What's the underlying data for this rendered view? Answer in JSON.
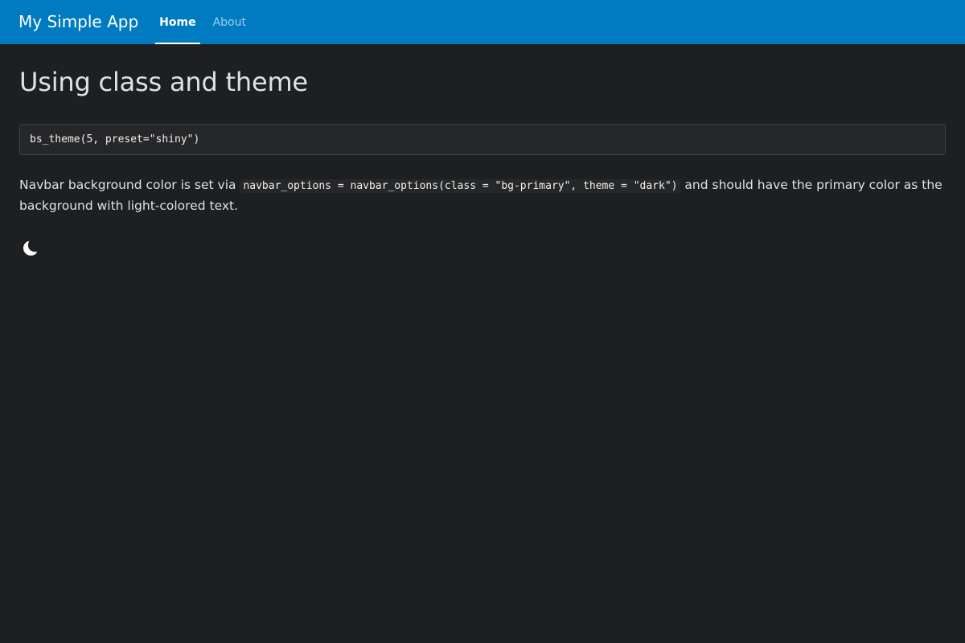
{
  "navbar": {
    "brand": "My Simple App",
    "tabs": [
      {
        "label": "Home",
        "active": true
      },
      {
        "label": "About",
        "active": false
      }
    ],
    "background_color": "#007bc2"
  },
  "main": {
    "heading": "Using class and theme",
    "code_block": "bs_theme(5, preset=\"shiny\")",
    "paragraph": {
      "before": "Navbar background color is set via ",
      "code": "navbar_options = navbar_options(class = \"bg-primary\", theme = \"dark\")",
      "after": " and should have the primary color as the background with light-colored text."
    },
    "theme_toggle_icon": "moon-icon"
  }
}
